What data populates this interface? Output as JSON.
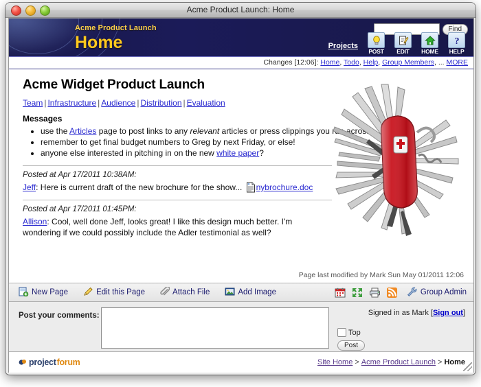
{
  "window": {
    "title": "Acme Product Launch: Home",
    "controls": [
      "close",
      "minimize",
      "zoom"
    ]
  },
  "banner": {
    "site_name": "Acme Product Launch",
    "page_name": "Home",
    "search": {
      "value": "",
      "placeholder": "",
      "find_label": "Find"
    },
    "projects_link": "Projects",
    "tools": [
      {
        "label": "POST",
        "icon": "lightbulb-icon"
      },
      {
        "label": "EDIT",
        "icon": "pencil-notepad-icon"
      },
      {
        "label": "HOME",
        "icon": "house-icon"
      },
      {
        "label": "HELP",
        "icon": "question-mark-icon"
      }
    ]
  },
  "changes": {
    "prefix": "Changes [12:06]:",
    "links": [
      "Home",
      "Todo",
      "Help",
      "Group Members"
    ],
    "ellipsis": "...",
    "more": "MORE"
  },
  "content": {
    "heading": "Acme Widget Product Launch",
    "nav_links": [
      "Team",
      "Infrastructure",
      "Audience",
      "Distribution",
      "Evaluation"
    ],
    "messages_heading": "Messages",
    "messages": [
      {
        "pre": "use the ",
        "link": "Articles",
        "mid": " page to post links to any ",
        "em": "relevant",
        "post": " articles or press clippings you run across"
      },
      {
        "pre": "remember to get final budget numbers to Greg by next Friday, or else!",
        "link": "",
        "mid": "",
        "em": "",
        "post": ""
      },
      {
        "pre": "anyone else interested in pitching in on the new ",
        "link": "white paper",
        "mid": "?",
        "em": "",
        "post": ""
      }
    ],
    "posts": [
      {
        "timestamp": "Posted at Apr 17/2011 10:38AM:",
        "author": "Jeff",
        "body": ": Here is current draft of the new brochure for the show... ",
        "attachment": "nybrochure.doc"
      },
      {
        "timestamp": "Posted at Apr 17/2011 01:45PM:",
        "author": "Allison",
        "body": ": Cool, well done Jeff, looks great! I like this design much better. I'm wondering if we could possibly include the Adler testimonial as well?",
        "attachment": ""
      }
    ],
    "image_alt": "swiss-army-knife-photo",
    "last_modified": "Page last modified by Mark Sun May 01/2011 12:06"
  },
  "actionbar": {
    "actions": [
      {
        "label": "New Page",
        "icon": "new-page-icon"
      },
      {
        "label": "Edit this Page",
        "icon": "pencil-icon"
      },
      {
        "label": "Attach File",
        "icon": "paperclip-icon"
      },
      {
        "label": "Add Image",
        "icon": "image-icon"
      }
    ],
    "mini_icons": [
      "calendar-icon",
      "expand-arrows-icon",
      "printer-icon",
      "rss-icon"
    ],
    "group_admin": {
      "label": "Group Admin",
      "icon": "wrench-icon"
    }
  },
  "comment_form": {
    "label": "Post your comments:",
    "value": "",
    "placeholder": "",
    "top_checkbox_label": "Top",
    "top_checked": false,
    "post_label": "Post",
    "signed_in_prefix": "Signed in as Mark [",
    "sign_out_label": "Sign out",
    "signed_in_suffix": "]"
  },
  "footer": {
    "logo_part1": "project",
    "logo_part2": "forum",
    "breadcrumbs": [
      {
        "label": "Site Home",
        "current": false
      },
      {
        "label": "Acme Product Launch",
        "current": false
      },
      {
        "label": "Home",
        "current": true
      }
    ],
    "separator": ">"
  },
  "colors": {
    "banner_navy": "#1b1b58",
    "accent_gold": "#ffc81e",
    "link_blue": "#2a2ad0",
    "crumb_purple": "#5a3b8c",
    "logo_orange": "#e08a13"
  }
}
